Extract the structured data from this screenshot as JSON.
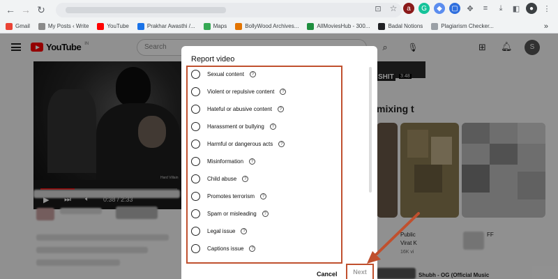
{
  "browser": {
    "bookmarks": [
      {
        "label": "Gmail",
        "color": "#ea4335"
      },
      {
        "label": "My Posts ‹ Write",
        "color": "#8a8a8a"
      },
      {
        "label": "YouTube",
        "color": "#ff0000"
      },
      {
        "label": "Prakhar Awasthi /...",
        "color": "#1a73e8"
      },
      {
        "label": "Maps",
        "color": "#34a853"
      },
      {
        "label": "BollyWood Archives...",
        "color": "#e37400"
      },
      {
        "label": "AllMoviesHub - 300...",
        "color": "#1e8e3e"
      },
      {
        "label": "Badal Notions",
        "color": "#202124"
      },
      {
        "label": "Plagiarism Checker...",
        "color": "#9aa0a6"
      }
    ],
    "more": "»"
  },
  "youtube": {
    "logo": "YouTube",
    "logo_sup": "IN",
    "search_placeholder": "Search",
    "avatar": "S",
    "player": {
      "time": "0:38 / 2:33",
      "watermark": "Hard Villain",
      "progress_fraction": 0.248
    },
    "sidebar": {
      "heading": "mixing t",
      "top_badge": "SHIT",
      "top_time": "3:48",
      "card1_line1": "Public",
      "card1_line2": "Virat K",
      "card1_meta": "16K vi",
      "card2_line1": "FF",
      "bottom_item": "Shubh - OG (Official Music"
    }
  },
  "dialog": {
    "title": "Report video",
    "options": [
      {
        "label": "Sexual content"
      },
      {
        "label": "Violent or repulsive content"
      },
      {
        "label": "Hateful or abusive content"
      },
      {
        "label": "Harassment or bullying"
      },
      {
        "label": "Harmful or dangerous acts"
      },
      {
        "label": "Misinformation"
      },
      {
        "label": "Child abuse"
      },
      {
        "label": "Promotes terrorism"
      },
      {
        "label": "Spam or misleading"
      },
      {
        "label": "Legal issue"
      },
      {
        "label": "Captions issue"
      }
    ],
    "cancel_label": "Cancel",
    "next_label": "Next"
  },
  "colors": {
    "annotation": "#c0502e",
    "youtube_red": "#ff0000",
    "overlay": "rgba(0,0,0,0.42)"
  },
  "icons": [
    "back-arrow-icon",
    "forward-arrow-icon",
    "reload-icon",
    "help-circle-icon",
    "search-icon",
    "mic-icon",
    "create-video-icon",
    "bell-icon",
    "play-icon",
    "next-track-icon",
    "volume-icon"
  ]
}
